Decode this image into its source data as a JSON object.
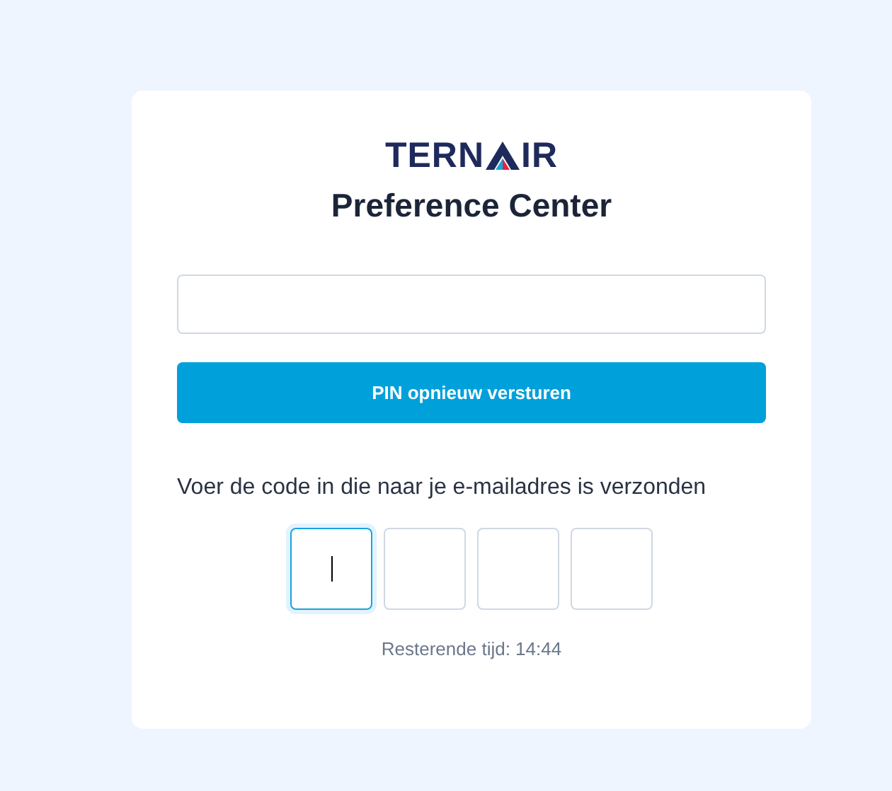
{
  "logo": {
    "before": "TERN",
    "after": "IR"
  },
  "title": "Preference Center",
  "email_field": {
    "focused": false
  },
  "resend_button": "PIN opnieuw versturen",
  "instruction": "Voer de code in die naar je e-mailadres is verzonden",
  "code_boxes": [
    {
      "focused": true
    },
    {
      "focused": false
    },
    {
      "focused": false
    },
    {
      "focused": false
    }
  ],
  "timer": "Resterende tijd: 14:44"
}
